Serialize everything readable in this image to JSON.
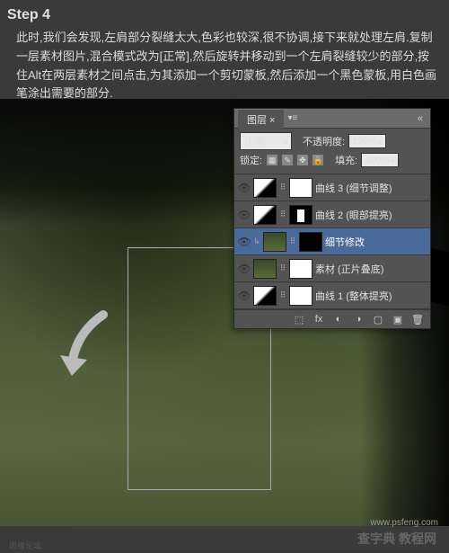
{
  "step_label": "Step 4",
  "instructions": "此时,我们会发现,左肩部分裂缝太大,色彩也较深,很不协调,接下来就处理左肩.复制一层素材图片,混合模式改为[正常],然后旋转并移动到一个左肩裂缝较少的部分,按住Alt在两层素材之间点击,为其添加一个剪切蒙板,然后添加一个黑色蒙板,用白色画笔涂出需要的部分.",
  "panel": {
    "title": "图层",
    "blend_mode": "正常",
    "opacity_label": "不透明度:",
    "opacity_value": "100%",
    "lock_label": "锁定:",
    "fill_label": "填充:",
    "fill_value": "100%"
  },
  "layers": [
    {
      "name": "曲线 3 (细节调整)",
      "type": "adj",
      "mask": "white",
      "eye": true
    },
    {
      "name": "曲线 2 (眼部提亮)",
      "type": "adj",
      "mask": "partial",
      "eye": true
    },
    {
      "name": "细节修改",
      "type": "img",
      "mask": "black",
      "eye": true,
      "selected": true,
      "clip": true
    },
    {
      "name": "素材 (正片叠底)",
      "type": "img",
      "mask": "white",
      "eye": true
    },
    {
      "name": "曲线 1 (整体提亮)",
      "type": "adj",
      "mask": "white",
      "eye": true
    }
  ],
  "watermark": "查字典 教程网",
  "watermark_site": "jiaocheng",
  "footer_left": "思缘论坛",
  "footer_url": "www.psfeng.com"
}
